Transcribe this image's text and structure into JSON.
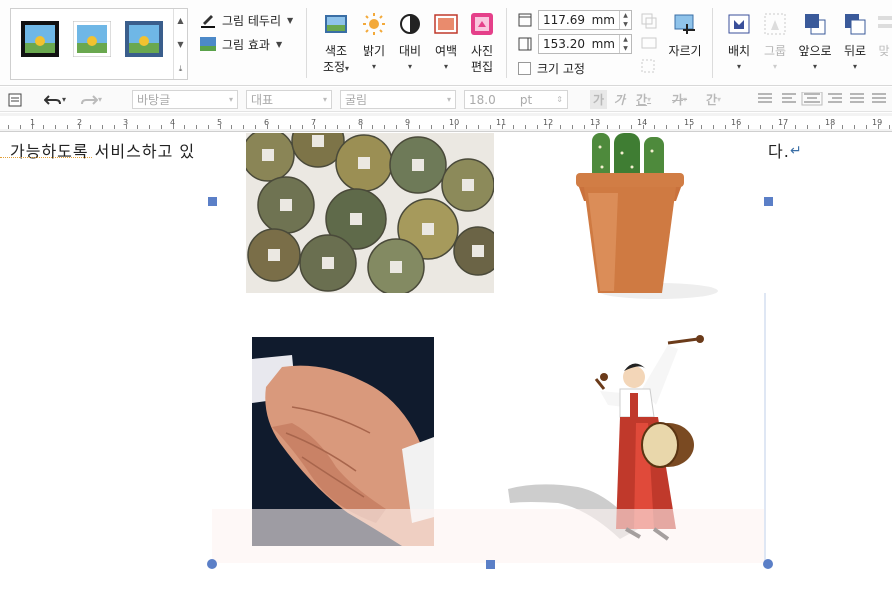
{
  "ribbon": {
    "border_menu": "그림 테두리",
    "effect_menu": "그림 효과",
    "buttons": {
      "color_adjust": [
        "색조",
        "조정"
      ],
      "brightness": "밝기",
      "contrast": "대비",
      "margin": "여백",
      "photo_edit": [
        "사진",
        "편집"
      ],
      "crop": "자르기",
      "arrange": "배치",
      "group": "그룹",
      "bring_forward": "앞으로",
      "send_backward": "뒤로",
      "align_partial": "맞"
    },
    "height": {
      "value": "117.69",
      "unit": "mm"
    },
    "width": {
      "value": "153.20",
      "unit": "mm"
    },
    "lock_size": "크기 고정"
  },
  "toolbar2": {
    "style": "바탕글",
    "representative": "대표",
    "font": "굴림",
    "size": "18.0",
    "size_unit": "pt",
    "bold": "가",
    "italic": "가",
    "underline": "간",
    "strike": "가",
    "shade": "간"
  },
  "ruler": {
    "labels": [
      "1",
      "2",
      "3",
      "4",
      "5",
      "6",
      "7",
      "8",
      "9",
      "10",
      "11",
      "12",
      "13",
      "14",
      "15",
      "16",
      "17",
      "18",
      "19"
    ]
  },
  "document": {
    "line_left": "가능하도록 서비스하고 있",
    "line_right": "다.",
    "paragraph_mark": "↵"
  },
  "colors": {
    "handle": "#5b7fc7",
    "accent": "#2e5aac"
  }
}
